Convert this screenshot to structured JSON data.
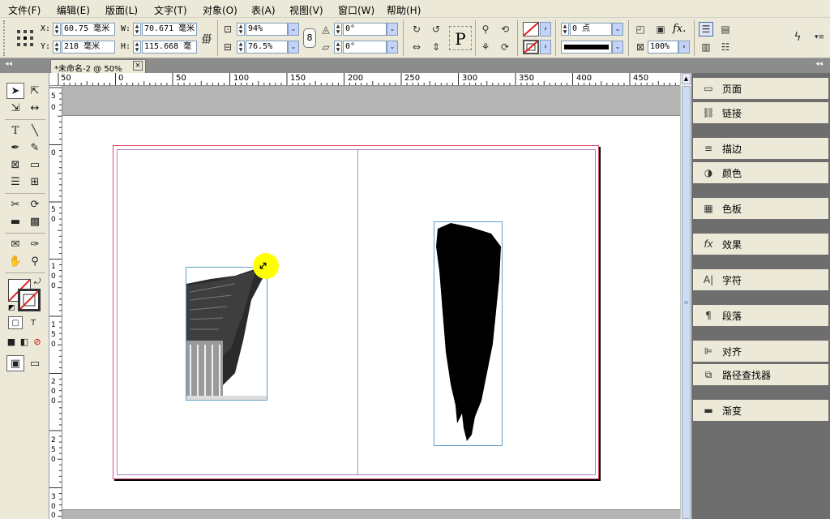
{
  "menubar": {
    "items": [
      "文件(F)",
      "编辑(E)",
      "版面(L)",
      "文字(T)",
      "对象(O)",
      "表(A)",
      "视图(V)",
      "窗口(W)",
      "帮助(H)"
    ]
  },
  "control": {
    "x_label": "X:",
    "x_value": "60.75 毫米",
    "y_label": "Y:",
    "y_value": "218 毫米",
    "w_label": "W:",
    "w_value": "70.671 毫米",
    "h_label": "H:",
    "h_value": "115.668 毫",
    "scale_x": "94%",
    "scale_y": "76.5%",
    "rotate": "0°",
    "shear": "0°",
    "stroke_weight": "0 点",
    "opacity": "100%",
    "text_p": "P",
    "fx": "fx."
  },
  "tab": {
    "title": "*未命名-2 @ 50%",
    "close": "×"
  },
  "ruler": {
    "h_labels": [
      "50",
      "0",
      "50",
      "100",
      "150",
      "200",
      "250",
      "300",
      "350",
      "400",
      "450"
    ],
    "v_labels": [
      "5",
      "0",
      "0",
      "5",
      "0",
      "1",
      "0",
      "0",
      "1",
      "5",
      "0",
      "2",
      "0",
      "0",
      "2",
      "5",
      "0",
      "3",
      "0",
      "0"
    ]
  },
  "panels": [
    {
      "icon": "page-icon",
      "glyph": "▭",
      "label": "页面"
    },
    {
      "icon": "links-icon",
      "glyph": "⛓",
      "label": "链接"
    },
    {
      "icon": "stroke-icon",
      "glyph": "≡",
      "label": "描边"
    },
    {
      "icon": "color-icon",
      "glyph": "◑",
      "label": "颜色"
    },
    {
      "icon": "swatches-icon",
      "glyph": "▦",
      "label": "色板"
    },
    {
      "icon": "effects-icon",
      "glyph": "fx",
      "label": "效果"
    },
    {
      "icon": "character-icon",
      "glyph": "A|",
      "label": "字符"
    },
    {
      "icon": "paragraph-icon",
      "glyph": "¶",
      "label": "段落"
    },
    {
      "icon": "align-icon",
      "glyph": "⊫",
      "label": "对齐"
    },
    {
      "icon": "pathfinder-icon",
      "glyph": "⧉",
      "label": "路径查找器"
    },
    {
      "icon": "gradient-icon",
      "glyph": "▬",
      "label": "渐变"
    }
  ],
  "colors": {
    "accent": "#c4d3f7",
    "frame": "#5f9fc7",
    "guide": "#d94c6d",
    "highlight": "#ffff00"
  }
}
